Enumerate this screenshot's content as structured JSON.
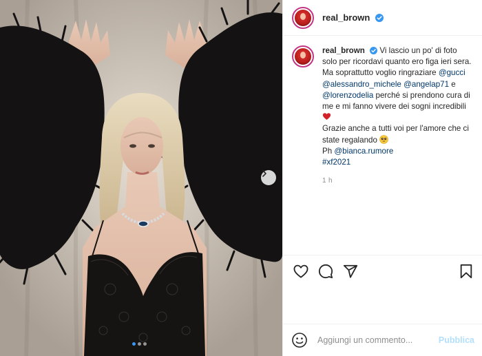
{
  "post": {
    "username": "real_brown",
    "verified": true,
    "caption": {
      "username": "real_brown",
      "text_1": "Vi lascio un po' di foto solo per ricordavi quanto ero figa ieri sera.",
      "text_2": "Ma soprattutto voglio ringraziare ",
      "mention_gucci": "@gucci",
      "mention_alessandro": "@alessandro_michele",
      "mention_angela": "@angelap71",
      "and": " e ",
      "mention_lorenzo": "@lorenzodelia",
      "text_3": " perché si prendono cura di me e mi fanno vivere dei sogni incredibili ",
      "text_4": "Grazie anche a tutti voi per l'amore che ci state regalando ",
      "ph_label": "Ph ",
      "mention_bianca": "@bianca.rumore",
      "hashtag": "#xf2021"
    },
    "timestamp": "1 h"
  },
  "carousel": {
    "slide_count": 3,
    "active_slide": 1
  },
  "comment": {
    "placeholder": "Aggiungi un commento...",
    "publish_label": "Pubblica"
  },
  "icons": {
    "verified": "verified-badge-icon",
    "like": "heart-icon",
    "comment": "comment-icon",
    "share": "paper-plane-icon",
    "save": "bookmark-icon",
    "emoji": "smiley-icon",
    "next": "chevron-right-icon"
  },
  "colors": {
    "link": "#00376b",
    "verified": "#3897f0",
    "publish_disabled": "#b2dffc",
    "secondary_text": "#8e8e8e"
  }
}
